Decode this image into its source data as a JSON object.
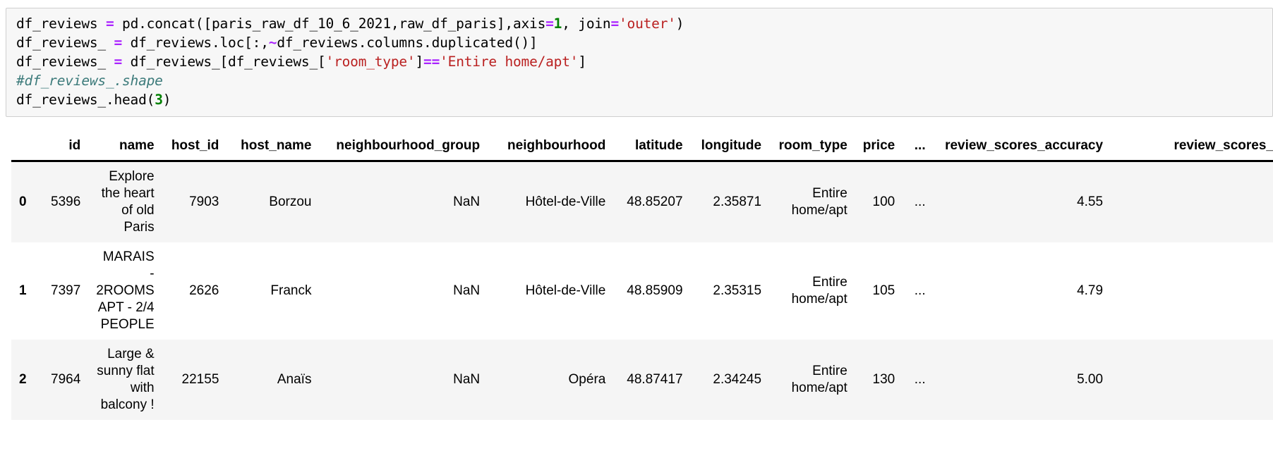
{
  "code_cell": {
    "lines": [
      [
        {
          "t": "df_reviews ",
          "c": "plain"
        },
        {
          "t": "=",
          "c": "op"
        },
        {
          "t": " pd.concat([paris_raw_df_10_6_2021,raw_df_paris],axis",
          "c": "plain"
        },
        {
          "t": "=",
          "c": "op"
        },
        {
          "t": "1",
          "c": "num"
        },
        {
          "t": ", join",
          "c": "plain"
        },
        {
          "t": "=",
          "c": "op"
        },
        {
          "t": "'outer'",
          "c": "str"
        },
        {
          "t": ")",
          "c": "plain"
        }
      ],
      [
        {
          "t": "df_reviews_ ",
          "c": "plain"
        },
        {
          "t": "=",
          "c": "op"
        },
        {
          "t": " df_reviews.loc[:,",
          "c": "plain"
        },
        {
          "t": "~",
          "c": "op"
        },
        {
          "t": "df_reviews.columns.duplicated()]",
          "c": "plain"
        }
      ],
      [
        {
          "t": "df_reviews_ ",
          "c": "plain"
        },
        {
          "t": "=",
          "c": "op"
        },
        {
          "t": " df_reviews_[df_reviews_[",
          "c": "plain"
        },
        {
          "t": "'room_type'",
          "c": "str"
        },
        {
          "t": "]",
          "c": "plain"
        },
        {
          "t": "==",
          "c": "op"
        },
        {
          "t": "'Entire home/apt'",
          "c": "str"
        },
        {
          "t": "]",
          "c": "plain"
        }
      ],
      [
        {
          "t": "#df_reviews_.shape",
          "c": "cmt"
        }
      ],
      [
        {
          "t": "df_reviews_.head(",
          "c": "plain"
        },
        {
          "t": "3",
          "c": "num"
        },
        {
          "t": ")",
          "c": "plain"
        }
      ]
    ],
    "colors": {
      "background": "#f7f7f7",
      "border": "#cfcfcf",
      "text": "#000000",
      "operator": "#aa22ff",
      "string": "#ba2121",
      "number": "#008000",
      "comment": "#3d7b7b"
    }
  },
  "dataframe": {
    "columns": [
      "",
      "id",
      "name",
      "host_id",
      "host_name",
      "neighbourhood_group",
      "neighbourhood",
      "latitude",
      "longitude",
      "room_type",
      "price",
      "...",
      "review_scores_accuracy",
      "review_scores_"
    ],
    "rows": [
      {
        "index": "0",
        "id": "5396",
        "name": "Explore the heart of old Paris",
        "host_id": "7903",
        "host_name": "Borzou",
        "neighbourhood_group": "NaN",
        "neighbourhood": "Hôtel-de-Ville",
        "latitude": "48.85207",
        "longitude": "2.35871",
        "room_type": "Entire home/apt",
        "price": "100",
        "ellipsis": "...",
        "review_scores_accuracy": "4.55",
        "review_scores_last": ""
      },
      {
        "index": "1",
        "id": "7397",
        "name": "MARAIS - 2ROOMS APT - 2/4 PEOPLE",
        "host_id": "2626",
        "host_name": "Franck",
        "neighbourhood_group": "NaN",
        "neighbourhood": "Hôtel-de-Ville",
        "latitude": "48.85909",
        "longitude": "2.35315",
        "room_type": "Entire home/apt",
        "price": "105",
        "ellipsis": "...",
        "review_scores_accuracy": "4.79",
        "review_scores_last": ""
      },
      {
        "index": "2",
        "id": "7964",
        "name": "Large & sunny flat with balcony !",
        "host_id": "22155",
        "host_name": "Anaïs",
        "neighbourhood_group": "NaN",
        "neighbourhood": "Opéra",
        "latitude": "48.87417",
        "longitude": "2.34245",
        "room_type": "Entire home/apt",
        "price": "130",
        "ellipsis": "...",
        "review_scores_accuracy": "5.00",
        "review_scores_last": ""
      }
    ],
    "colors": {
      "stripe": "#f5f5f5",
      "header_rule": "#000000",
      "text": "#000000"
    }
  }
}
